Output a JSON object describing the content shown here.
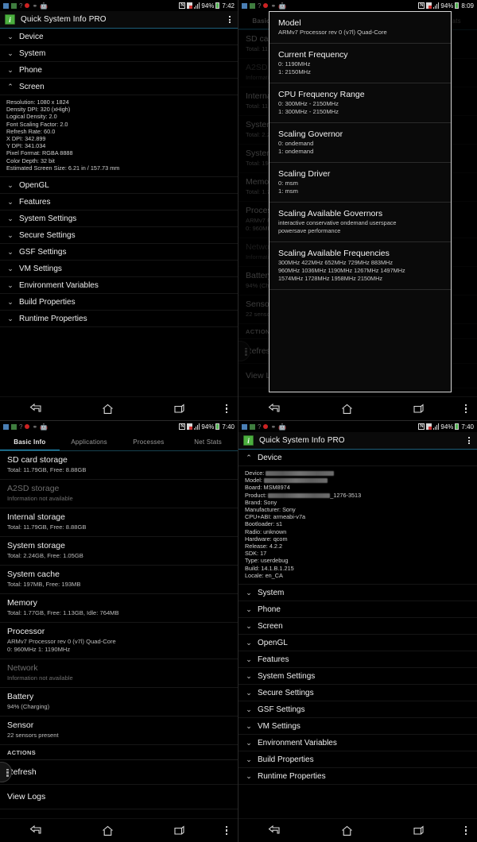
{
  "app": {
    "title": "Quick System Info PRO",
    "icon": "info-app-icon",
    "icon_glyph": "i",
    "accent": "#2196c4"
  },
  "status_bar": {
    "icons": [
      "sd-card-icon",
      "memory-icon",
      "help-icon",
      "record-icon",
      "usb-icon",
      "android-icon"
    ],
    "right_icons": [
      "nfc-icon",
      "screenshot-icon",
      "signal-icon",
      "battery-icon"
    ],
    "battery_pct": "94%",
    "times": {
      "panel1": "7:42",
      "panel2": "8:09",
      "panel3": "7:40",
      "panel4": "7:40"
    }
  },
  "nav_bar": {
    "back": "back-icon",
    "home": "home-icon",
    "recents": "recents-icon",
    "menu": "overflow-menu-icon"
  },
  "panel1": {
    "sections": [
      {
        "label": "Device",
        "expanded": false
      },
      {
        "label": "System",
        "expanded": false
      },
      {
        "label": "Phone",
        "expanded": false
      },
      {
        "label": "Screen",
        "expanded": true
      },
      {
        "label": "OpenGL",
        "expanded": false
      },
      {
        "label": "Features",
        "expanded": false
      },
      {
        "label": "System Settings",
        "expanded": false
      },
      {
        "label": "Secure Settings",
        "expanded": false
      },
      {
        "label": "GSF Settings",
        "expanded": false
      },
      {
        "label": "VM Settings",
        "expanded": false
      },
      {
        "label": "Environment Variables",
        "expanded": false
      },
      {
        "label": "Build Properties",
        "expanded": false
      },
      {
        "label": "Runtime Properties",
        "expanded": false
      }
    ],
    "screen_details": [
      "Resolution: 1080 x 1824",
      "Density DPI: 320 (xHigh)",
      "Logical Density: 2.0",
      "Font Scaling Factor: 2.0",
      "Refresh Rate: 60.0",
      "X DPI: 342.899",
      "Y DPI: 341.034",
      "Pixel Format: RGBA 8888",
      "Color Depth: 32 bit",
      "Estimated Screen Size: 6.21 in / 157.73 mm"
    ]
  },
  "panel2": {
    "dialog": {
      "blocks": [
        {
          "title": "Model",
          "lines": [
            "ARMv7 Processor rev 0 (v7l) Quad-Core"
          ]
        },
        {
          "title": "Current Frequency",
          "lines": [
            "0: 1190MHz",
            "1: 2150MHz"
          ]
        },
        {
          "title": "CPU Frequency Range",
          "lines": [
            "0: 300MHz - 2150MHz",
            "1: 300MHz - 2150MHz"
          ]
        },
        {
          "title": "Scaling Governor",
          "lines": [
            "0: ondemand",
            "1: ondemand"
          ]
        },
        {
          "title": "Scaling Driver",
          "lines": [
            "0: msm",
            "1: msm"
          ]
        },
        {
          "title": "Scaling Available Governors",
          "lines": [
            "interactive conservative ondemand userspace",
            "powersave performance"
          ]
        },
        {
          "title": "Scaling Available Frequencies",
          "lines": [
            "300MHz  422MHz  652MHz  729MHz  883MHz",
            "960MHz  1036MHz  1190MHz  1267MHz  1497MHz",
            "1574MHz  1728MHz  1958MHz  2150MHz"
          ]
        }
      ]
    }
  },
  "panel3": {
    "tabs": [
      {
        "label": "Basic Info",
        "active": true
      },
      {
        "label": "Applications",
        "active": false
      },
      {
        "label": "Processes",
        "active": false
      },
      {
        "label": "Net Stats",
        "active": false
      }
    ],
    "items": [
      {
        "title": "SD card storage",
        "sub": "Total: 11.79GB, Free: 8.88GB",
        "dim": false
      },
      {
        "title": "A2SD storage",
        "sub": "Information not available",
        "dim": true
      },
      {
        "title": "Internal storage",
        "sub": "Total: 11.79GB, Free: 8.88GB",
        "dim": false
      },
      {
        "title": "System storage",
        "sub": "Total: 2.24GB, Free: 1.05GB",
        "dim": false
      },
      {
        "title": "System cache",
        "sub": "Total: 197MB, Free: 193MB",
        "dim": false
      },
      {
        "title": "Memory",
        "sub": "Total: 1.77GB, Free: 1.13GB, Idle: 764MB",
        "dim": false
      },
      {
        "title": "Processor",
        "sub": "ARMv7 Processor rev 0 (v7l) Quad-Core\n0: 960MHz  1: 1190MHz",
        "dim": false
      },
      {
        "title": "Network",
        "sub": "Information not available",
        "dim": true
      },
      {
        "title": "Battery",
        "sub": "94% (Charging)",
        "dim": false
      },
      {
        "title": "Sensor",
        "sub": "22 sensors present",
        "dim": false
      }
    ],
    "actions_caption": "ACTIONS",
    "actions": [
      {
        "label": "Refresh"
      },
      {
        "label": "View Logs"
      }
    ]
  },
  "panel4": {
    "sections": [
      {
        "label": "Device",
        "expanded": true
      },
      {
        "label": "System",
        "expanded": false
      },
      {
        "label": "Phone",
        "expanded": false
      },
      {
        "label": "Screen",
        "expanded": false
      },
      {
        "label": "OpenGL",
        "expanded": false
      },
      {
        "label": "Features",
        "expanded": false
      },
      {
        "label": "System Settings",
        "expanded": false
      },
      {
        "label": "Secure Settings",
        "expanded": false
      },
      {
        "label": "GSF Settings",
        "expanded": false
      },
      {
        "label": "VM Settings",
        "expanded": false
      },
      {
        "label": "Environment Variables",
        "expanded": false
      },
      {
        "label": "Build Properties",
        "expanded": false
      },
      {
        "label": "Runtime Properties",
        "expanded": false
      }
    ],
    "device_details": [
      {
        "label": "Device:",
        "value": "",
        "redacted": 86
      },
      {
        "label": "Model:",
        "value": "",
        "redacted": 80
      },
      {
        "label": "Board:",
        "value": "MSM8974",
        "redacted": 0
      },
      {
        "label": "Product:",
        "value": "_1276-3513",
        "redacted": 78
      },
      {
        "label": "Brand:",
        "value": "Sony",
        "redacted": 0
      },
      {
        "label": "Manufacturer:",
        "value": "Sony",
        "redacted": 0
      },
      {
        "label": "CPU+ABI:",
        "value": "armeabi-v7a",
        "redacted": 0
      },
      {
        "label": "Bootloader:",
        "value": "s1",
        "redacted": 0
      },
      {
        "label": "Radio:",
        "value": "unknown",
        "redacted": 0
      },
      {
        "label": "Hardware:",
        "value": "qcom",
        "redacted": 0
      },
      {
        "label": "Release:",
        "value": "4.2.2",
        "redacted": 0
      },
      {
        "label": "SDK:",
        "value": "17",
        "redacted": 0
      },
      {
        "label": "Type:",
        "value": "userdebug",
        "redacted": 0
      },
      {
        "label": "Build:",
        "value": "14.1.B.1.215",
        "redacted": 0
      },
      {
        "label": "Locale:",
        "value": "en_CA",
        "redacted": 0
      }
    ]
  }
}
